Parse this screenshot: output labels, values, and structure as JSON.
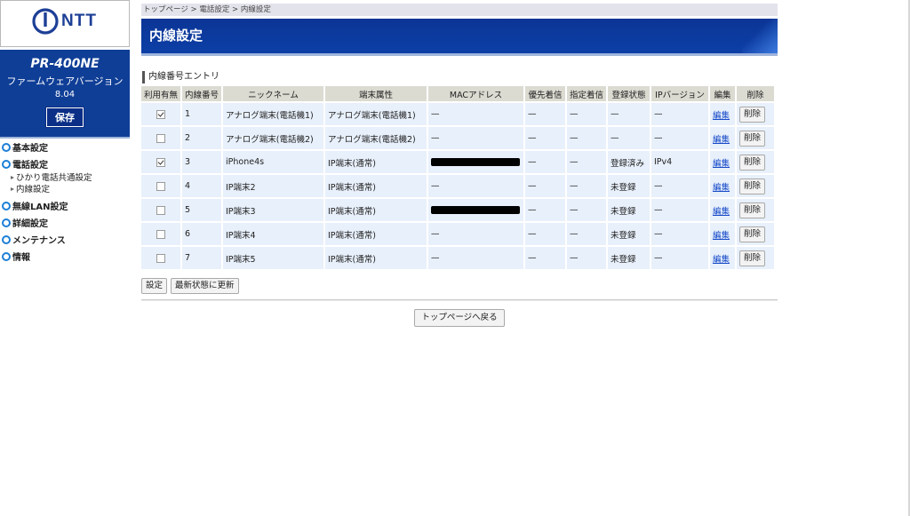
{
  "sidebar": {
    "logo_text": "NTT",
    "model": "PR-400NE",
    "firmware_label": "ファームウェアバージョン",
    "firmware_version": "8.04",
    "save_label": "保存",
    "nav": [
      {
        "label": "基本設定",
        "subs": []
      },
      {
        "label": "電話設定",
        "subs": [
          "ひかり電話共通設定",
          "内線設定"
        ]
      },
      {
        "label": "無線LAN設定",
        "subs": []
      },
      {
        "label": "詳細設定",
        "subs": []
      },
      {
        "label": "メンテナンス",
        "subs": []
      },
      {
        "label": "情報",
        "subs": []
      }
    ]
  },
  "main": {
    "breadcrumb": "トップページ > 電話設定 > 内線設定",
    "title": "内線設定",
    "section_title": "内線番号エントリ",
    "columns": [
      "利用有無",
      "内線番号",
      "ニックネーム",
      "端末属性",
      "MACアドレス",
      "優先着信",
      "指定着信",
      "登録状態",
      "IPバージョン",
      "編集",
      "削除"
    ],
    "rows": [
      {
        "enabled": true,
        "number": "1",
        "nickname": "アナログ端末(電話機1)",
        "type": "アナログ端末(電話機1)",
        "mac": "—",
        "mac_redacted": false,
        "priority": "—",
        "designated": "—",
        "status": "—",
        "ipver": "—",
        "edit": "編集",
        "delete": "削除"
      },
      {
        "enabled": false,
        "number": "2",
        "nickname": "アナログ端末(電話機2)",
        "type": "アナログ端末(電話機2)",
        "mac": "—",
        "mac_redacted": false,
        "priority": "—",
        "designated": "—",
        "status": "—",
        "ipver": "—",
        "edit": "編集",
        "delete": "削除"
      },
      {
        "enabled": true,
        "number": "3",
        "nickname": "iPhone4s",
        "type": "IP端末(通常)",
        "mac": "",
        "mac_redacted": true,
        "priority": "—",
        "designated": "—",
        "status": "登録済み",
        "ipver": "IPv4",
        "edit": "編集",
        "delete": "削除"
      },
      {
        "enabled": false,
        "number": "4",
        "nickname": "IP端末2",
        "type": "IP端末(通常)",
        "mac": "—",
        "mac_redacted": false,
        "priority": "—",
        "designated": "—",
        "status": "未登録",
        "ipver": "—",
        "edit": "編集",
        "delete": "削除"
      },
      {
        "enabled": false,
        "number": "5",
        "nickname": "IP端末3",
        "type": "IP端末(通常)",
        "mac": "",
        "mac_redacted": true,
        "priority": "—",
        "designated": "—",
        "status": "未登録",
        "ipver": "—",
        "edit": "編集",
        "delete": "削除"
      },
      {
        "enabled": false,
        "number": "6",
        "nickname": "IP端末4",
        "type": "IP端末(通常)",
        "mac": "—",
        "mac_redacted": false,
        "priority": "—",
        "designated": "—",
        "status": "未登録",
        "ipver": "—",
        "edit": "編集",
        "delete": "削除"
      },
      {
        "enabled": false,
        "number": "7",
        "nickname": "IP端末5",
        "type": "IP端末(通常)",
        "mac": "—",
        "mac_redacted": false,
        "priority": "—",
        "designated": "—",
        "status": "未登録",
        "ipver": "—",
        "edit": "編集",
        "delete": "削除"
      }
    ],
    "apply_label": "設定",
    "refresh_label": "最新状態に更新",
    "back_label": "トップページへ戻る"
  },
  "colors": {
    "brand_blue": "#0f3e96",
    "link_blue": "#1549c8",
    "nav_dot": "#1d7fd6"
  }
}
